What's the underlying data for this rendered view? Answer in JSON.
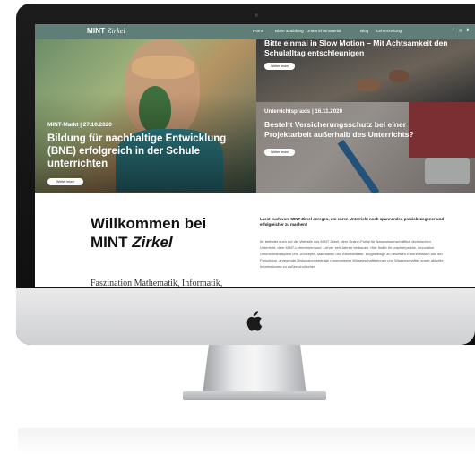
{
  "site": {
    "logo_main": "MINT",
    "logo_italic": "Zirkel",
    "nav": [
      "Home",
      "Blare & Bildung",
      "Unterrichtsmaterial",
      "Blog",
      "Lehrerzeitung"
    ],
    "social_icons": [
      "facebook-icon",
      "instagram-icon",
      "twitter-icon"
    ],
    "social_glyphs": [
      "f",
      "◎",
      "❥"
    ],
    "brand_color": "#5f7e78"
  },
  "hero_left": {
    "kicker": "MINT-Markt | 27.10.2020",
    "headline": "Bildung für nachhaltige Entwicklung (BNE) erfolgreich in der Schule unterrichten",
    "button": "Weiter lesen"
  },
  "hero_right_top": {
    "headline": "Bitte einmal in Slow Motion – Mit Achtsamkeit den Schulalltag entschleunigen",
    "button": "Weiter lesen"
  },
  "hero_right_bottom": {
    "kicker": "Unterrichtspraxis | 16.11.2020",
    "headline": "Besteht Versicherungsschutz bei einer Projektarbeit außerhalb des Unterrichts?",
    "button": "Weiter lesen"
  },
  "welcome": {
    "title_line1": "Willkommen bei",
    "title_line2_main": "MINT",
    "title_line2_italic": "Zirkel",
    "subtitle": "Faszination Mathematik, Informatik,",
    "lead": "Lasst euch vom MINT Zirkel anregen, um euren Unterricht noch spannender, praxisbezogener und erfolgreicher zu machen!",
    "body": "Ihr befindet euch auf der Website des MINT Zirkel, dem Online-Portal für Naturwissenschaftlich-technischen Unterricht, dem MINT-Lehrerinnen und -Lehrer seit Jahren vertrauen. Hier findet ihr praxiserprobte, innovative Unterrichtsbeispiele und -konzepte, Materialien und Arbeitsblätter, Blogbeiträge zu neuesten Erkenntnissen aus der Forschung, anregende Diskussionsbeiträge renommierter Wissenschaftlerinnen und Wissenschaftler sowie aktuelle Informationen zu außerschulischen"
  }
}
